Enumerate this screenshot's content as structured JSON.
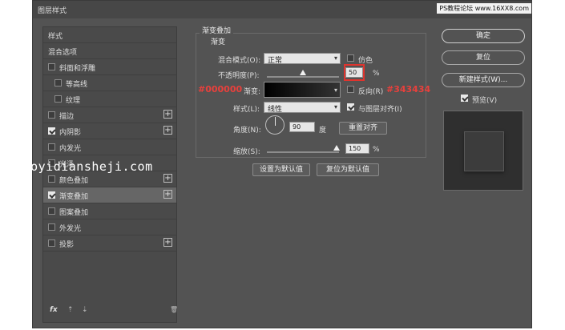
{
  "window": {
    "title": "图层样式",
    "close": "✕",
    "watermark": "PS教程论坛 www.16XX8.com"
  },
  "styles_list": {
    "items": [
      {
        "label": "样式",
        "checkbox": false,
        "checked": false,
        "plus": false,
        "selected": false,
        "indent": 0
      },
      {
        "label": "混合选项",
        "checkbox": false,
        "checked": false,
        "plus": false,
        "selected": false,
        "indent": 0
      },
      {
        "label": "斜面和浮雕",
        "checkbox": true,
        "checked": false,
        "plus": false,
        "selected": false,
        "indent": 0
      },
      {
        "label": "等高线",
        "checkbox": true,
        "checked": false,
        "plus": false,
        "selected": false,
        "indent": 1
      },
      {
        "label": "纹理",
        "checkbox": true,
        "checked": false,
        "plus": false,
        "selected": false,
        "indent": 1
      },
      {
        "label": "描边",
        "checkbox": true,
        "checked": false,
        "plus": true,
        "selected": false,
        "indent": 0
      },
      {
        "label": "内阴影",
        "checkbox": true,
        "checked": true,
        "plus": true,
        "selected": false,
        "indent": 0
      },
      {
        "label": "内发光",
        "checkbox": true,
        "checked": false,
        "plus": false,
        "selected": false,
        "indent": 0
      },
      {
        "label": "光泽",
        "checkbox": true,
        "checked": false,
        "plus": false,
        "selected": false,
        "indent": 0
      },
      {
        "label": "颜色叠加",
        "checkbox": true,
        "checked": false,
        "plus": true,
        "selected": false,
        "indent": 0
      },
      {
        "label": "渐变叠加",
        "checkbox": true,
        "checked": true,
        "plus": true,
        "selected": true,
        "indent": 0
      },
      {
        "label": "图案叠加",
        "checkbox": true,
        "checked": false,
        "plus": false,
        "selected": false,
        "indent": 0
      },
      {
        "label": "外发光",
        "checkbox": true,
        "checked": false,
        "plus": false,
        "selected": false,
        "indent": 0
      },
      {
        "label": "投影",
        "checkbox": true,
        "checked": false,
        "plus": true,
        "selected": false,
        "indent": 0
      }
    ],
    "footer": {
      "fx": "fx",
      "up": "⇡",
      "down": "⇣",
      "trash": "🗑"
    }
  },
  "gradient_overlay": {
    "group_title": "渐变叠加",
    "subgroup": "渐变",
    "blend_mode_label": "混合模式(O):",
    "blend_mode_value": "正常",
    "dither_label": "仿色",
    "opacity_label": "不透明度(P):",
    "opacity_value": "50",
    "opacity_unit": "%",
    "opacity_fraction": 0.5,
    "gradient_label": "渐变:",
    "reverse_label": "反向(R)",
    "style_label": "样式(L):",
    "style_value": "线性",
    "align_label": "与图层对齐(I)",
    "angle_label": "角度(N):",
    "angle_value": "90",
    "angle_unit": "度",
    "reset_align_button": "重置对齐",
    "scale_label": "缩放(S):",
    "scale_value": "150",
    "scale_unit": "%",
    "scale_fraction": 0.97,
    "make_default_button": "设置为默认值",
    "reset_default_button": "复位为默认值"
  },
  "annotations": {
    "color_left": "#000000",
    "color_right": "#343434",
    "site_overlay": "z.haoyidiansheji.com"
  },
  "right_buttons": {
    "ok": "确定",
    "reset": "复位",
    "new_style": "新建样式(W)...",
    "preview_label": "预览(V)"
  },
  "colors": {
    "panel_bg": "#535353",
    "selected_row": "#666666",
    "annotation_red": "#e8403c"
  }
}
